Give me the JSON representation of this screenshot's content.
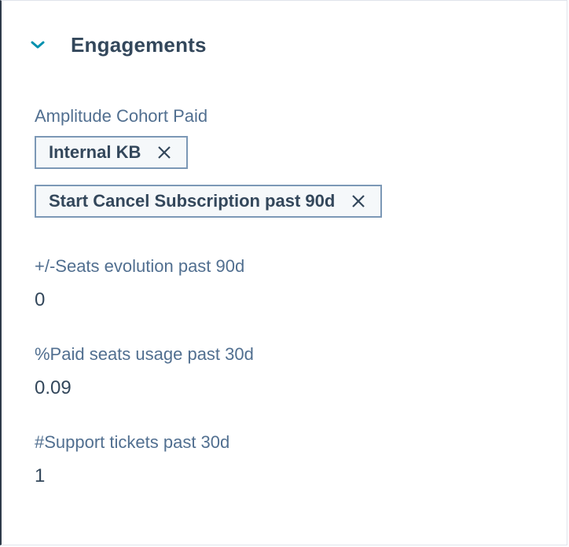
{
  "section": {
    "title": "Engagements"
  },
  "cohort": {
    "label": "Amplitude Cohort Paid",
    "tags": [
      {
        "label": "Internal KB"
      },
      {
        "label": "Start Cancel Subscription past 90d"
      }
    ]
  },
  "fields": [
    {
      "label": "+/-Seats evolution past 90d",
      "value": "0"
    },
    {
      "label": "%Paid seats usage past 30d",
      "value": "0.09"
    },
    {
      "label": "#Support tickets past 30d",
      "value": "1"
    }
  ],
  "colors": {
    "accent": "#0091ae",
    "title": "#33475b",
    "label": "#516f90",
    "tag_border": "#7c98b6",
    "tag_bg": "#f5f8fa"
  },
  "icons": {
    "collapse": "chevron-down-icon",
    "remove": "close-icon"
  }
}
